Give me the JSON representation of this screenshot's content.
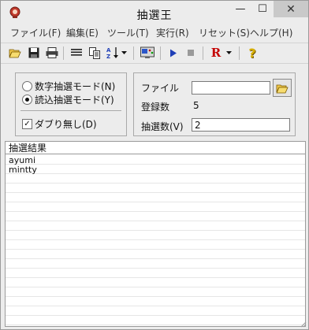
{
  "window": {
    "title": "抽選王"
  },
  "menu": [
    {
      "label": "ファイル(F)"
    },
    {
      "label": "編集(E)"
    },
    {
      "label": "ツール(T)"
    },
    {
      "label": "実行(R)"
    },
    {
      "label": "リセット(S)"
    },
    {
      "label": "ヘルプ(H)"
    }
  ],
  "toolbar": {
    "icons": [
      "open-folder-icon",
      "save-icon",
      "print-icon",
      "list-icon",
      "copy-icon",
      "sort-az-icon",
      "dropdown-arrow-icon",
      "settings-icon",
      "play-icon",
      "stop-icon",
      "reset-r-icon",
      "dropdown-arrow-icon",
      "help-icon"
    ],
    "reset_label": "R"
  },
  "mode": {
    "option_number": "数字抽選モード(N)",
    "option_entry": "読込抽選モード(Y)",
    "selected": "entry",
    "no_duplicates_label": "ダブり無し(D)",
    "no_duplicates_checked": true
  },
  "fileinfo": {
    "file_label": "ファイル",
    "file_value": "",
    "count_label": "登録数",
    "count_value": "5",
    "draw_label": "抽選数(V)",
    "draw_value": "2"
  },
  "results": {
    "header": "抽選結果",
    "items": [
      "ayumi",
      "mintty"
    ]
  },
  "colors": {
    "play": "#1f3fb7",
    "reset": "#c40000",
    "help": "#d8b000",
    "stop": "#9a9a9a"
  }
}
